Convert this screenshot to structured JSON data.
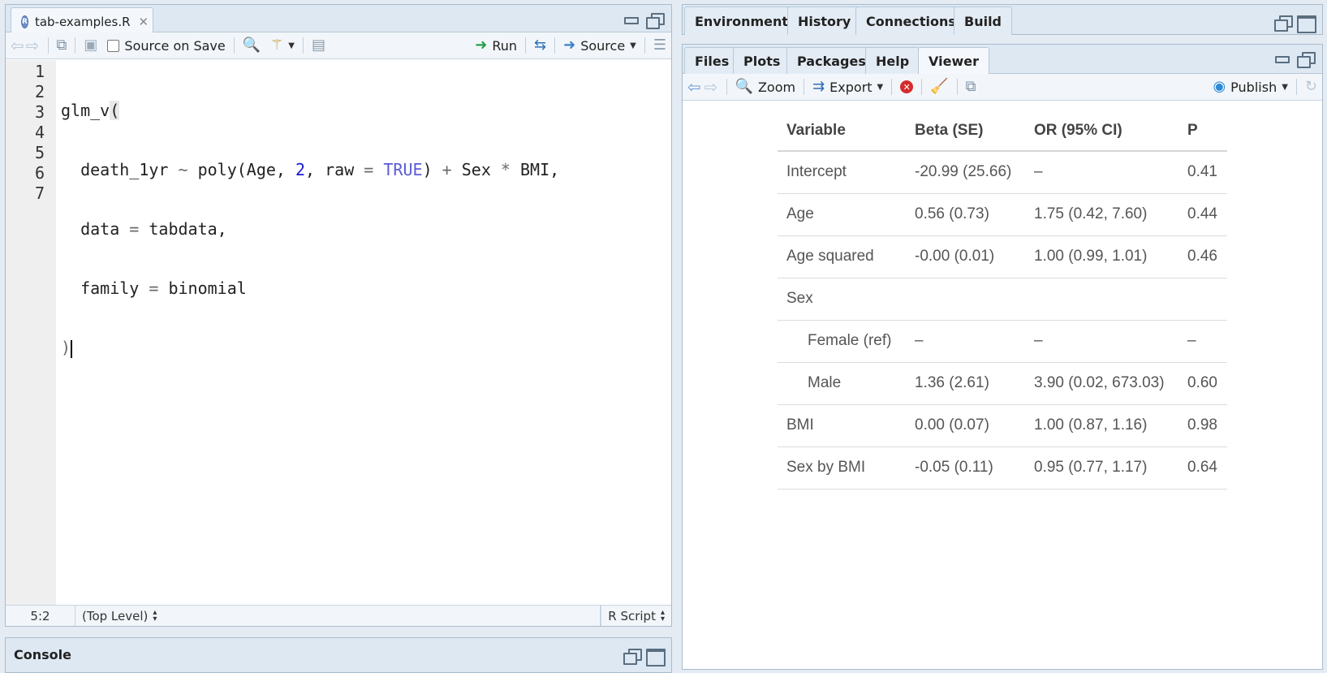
{
  "source": {
    "file_tab": "tab-examples.R",
    "toolbar": {
      "source_on_save": "Source on Save",
      "run": "Run",
      "source": "Source"
    },
    "line_numbers": [
      "1",
      "2",
      "3",
      "4",
      "5",
      "6",
      "7"
    ],
    "status": {
      "position": "5:2",
      "scope": "(Top Level)",
      "file_type": "R Script"
    }
  },
  "console": {
    "title": "Console"
  },
  "env_tabs": [
    "Environment",
    "History",
    "Connections",
    "Build"
  ],
  "viewer_tabs": [
    "Files",
    "Plots",
    "Packages",
    "Help",
    "Viewer"
  ],
  "viewer_toolbar": {
    "zoom": "Zoom",
    "export": "Export",
    "publish": "Publish"
  },
  "table": {
    "headers": [
      "Variable",
      "Beta (SE)",
      "OR (95% CI)",
      "P"
    ],
    "rows": [
      [
        "Intercept",
        "-20.99 (25.66)",
        "–",
        "0.41"
      ],
      [
        "Age",
        "0.56 (0.73)",
        "1.75 (0.42, 7.60)",
        "0.44"
      ],
      [
        "Age squared",
        "-0.00 (0.01)",
        "1.00 (0.99, 1.01)",
        "0.46"
      ],
      [
        "Sex",
        "",
        "",
        ""
      ],
      [
        "Female (ref)",
        "–",
        "–",
        "–"
      ],
      [
        "Male",
        "1.36 (2.61)",
        "3.90 (0.02, 673.03)",
        "0.60"
      ],
      [
        "BMI",
        "0.00 (0.07)",
        "1.00 (0.87, 1.16)",
        "0.98"
      ],
      [
        "Sex by BMI",
        "-0.05 (0.11)",
        "0.95 (0.77, 1.17)",
        "0.64"
      ]
    ]
  },
  "colors": {
    "keyword": "#5b5bd6",
    "number": "#1a1ad0",
    "pane_header": "#dde8f3"
  }
}
